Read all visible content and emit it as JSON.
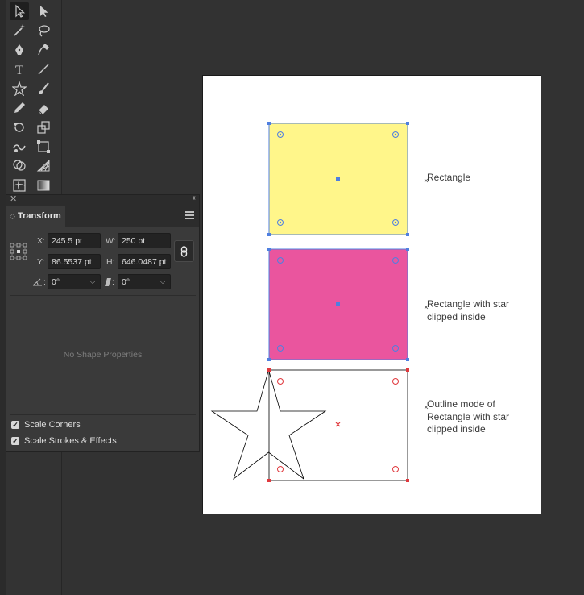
{
  "toolbar": {
    "tools": [
      {
        "name": "selection-tool",
        "icon": "selection-arrow-icon"
      },
      {
        "name": "direct-selection-tool",
        "icon": "direct-selection-arrow-icon"
      },
      {
        "name": "magic-wand-tool",
        "icon": "magic-wand-icon"
      },
      {
        "name": "lasso-tool",
        "icon": "lasso-icon"
      },
      {
        "name": "pen-tool",
        "icon": "pen-icon"
      },
      {
        "name": "curvature-tool",
        "icon": "curvature-icon"
      },
      {
        "name": "type-tool",
        "icon": "type-icon",
        "glyph": "T"
      },
      {
        "name": "line-segment-tool",
        "icon": "line-icon"
      },
      {
        "name": "star-tool",
        "icon": "star-icon"
      },
      {
        "name": "paintbrush-tool",
        "icon": "paintbrush-icon"
      },
      {
        "name": "pencil-tool",
        "icon": "pencil-icon"
      },
      {
        "name": "eraser-tool",
        "icon": "eraser-icon"
      },
      {
        "name": "rotate-tool",
        "icon": "rotate-icon"
      },
      {
        "name": "scale-tool",
        "icon": "scale-icon"
      },
      {
        "name": "warp-tool",
        "icon": "warp-icon"
      },
      {
        "name": "free-transform-tool",
        "icon": "free-transform-icon"
      },
      {
        "name": "shape-builder-tool",
        "icon": "shape-builder-icon"
      },
      {
        "name": "perspective-grid-tool",
        "icon": "perspective-grid-icon"
      },
      {
        "name": "mesh-tool",
        "icon": "mesh-icon"
      },
      {
        "name": "gradient-tool",
        "icon": "gradient-icon"
      }
    ]
  },
  "artboard": {
    "labels": {
      "rectangle": "Rectangle",
      "clipped": "Rectangle with star\nclipped inside",
      "outline": "Outline mode of\nRectangle with star\nclipped inside"
    },
    "colors": {
      "yellow_fill": "#FFF68A",
      "pink_fill": "#EA559E",
      "selection_blue": "#4F7FE0",
      "selection_red": "#E0393E"
    }
  },
  "transform_panel": {
    "tab_label": "Transform",
    "x_label": "X:",
    "x_value": "245.5 pt",
    "y_label": "Y:",
    "y_value": "86.5537 pt",
    "w_label": "W:",
    "w_value": "250 pt",
    "h_label": "H:",
    "h_value": "646.0487 pt",
    "rotate_value": "0°",
    "shear_value": "0°",
    "no_shape_properties": "No Shape Properties",
    "scale_corners_label": "Scale Corners",
    "scale_corners_checked": true,
    "scale_strokes_label": "Scale Strokes & Effects",
    "scale_strokes_checked": true
  }
}
